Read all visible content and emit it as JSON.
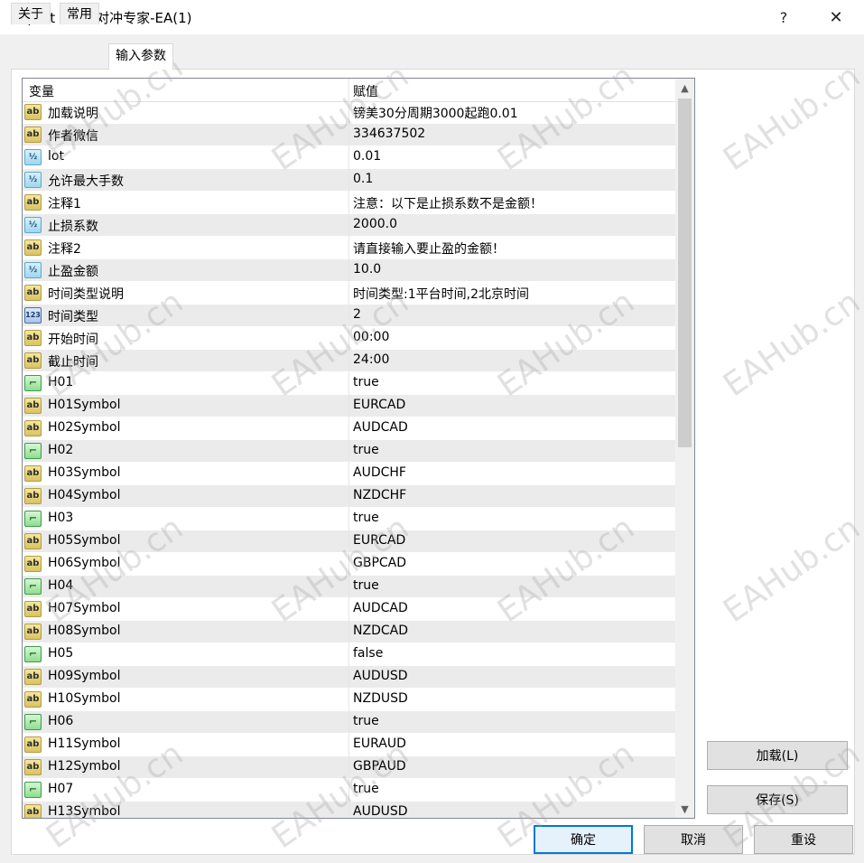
{
  "window": {
    "title": "Expert - 货币对冲专家-EA(1)",
    "help_glyph": "?",
    "close_glyph": "✕"
  },
  "tabs": [
    {
      "label": "关于"
    },
    {
      "label": "常用"
    },
    {
      "label": "输入参数"
    }
  ],
  "grid": {
    "col_variable": "变量",
    "col_value": "赋值",
    "rows": [
      {
        "type": "ab",
        "name": "加载说明",
        "value": "镑美30分周期3000起跑0.01"
      },
      {
        "type": "ab",
        "name": "作者微信",
        "value": "334637502"
      },
      {
        "type": "½",
        "name": "lot",
        "value": "0.01"
      },
      {
        "type": "½",
        "name": "允许最大手数",
        "value": "0.1"
      },
      {
        "type": "ab",
        "name": "注释1",
        "value": "注意：以下是止损系数不是金额！"
      },
      {
        "type": "½",
        "name": "止损系数",
        "value": "2000.0"
      },
      {
        "type": "ab",
        "name": "注释2",
        "value": "请直接输入要止盈的金额！"
      },
      {
        "type": "½",
        "name": "止盈金额",
        "value": "10.0"
      },
      {
        "type": "ab",
        "name": "时间类型说明",
        "value": "时间类型:1平台时间,2北京时间"
      },
      {
        "type": "123",
        "name": "时间类型",
        "value": "2"
      },
      {
        "type": "ab",
        "name": "开始时间",
        "value": "00:00"
      },
      {
        "type": "ab",
        "name": "截止时间",
        "value": "24:00"
      },
      {
        "type": "⌐",
        "name": "H01",
        "value": "true"
      },
      {
        "type": "ab",
        "name": "H01Symbol",
        "value": "EURCAD"
      },
      {
        "type": "ab",
        "name": "H02Symbol",
        "value": "AUDCAD"
      },
      {
        "type": "⌐",
        "name": "H02",
        "value": "true"
      },
      {
        "type": "ab",
        "name": "H03Symbol",
        "value": "AUDCHF"
      },
      {
        "type": "ab",
        "name": "H04Symbol",
        "value": "NZDCHF"
      },
      {
        "type": "⌐",
        "name": "H03",
        "value": "true"
      },
      {
        "type": "ab",
        "name": "H05Symbol",
        "value": "EURCAD"
      },
      {
        "type": "ab",
        "name": "H06Symbol",
        "value": "GBPCAD"
      },
      {
        "type": "⌐",
        "name": "H04",
        "value": "true"
      },
      {
        "type": "ab",
        "name": "H07Symbol",
        "value": "AUDCAD"
      },
      {
        "type": "ab",
        "name": "H08Symbol",
        "value": "NZDCAD"
      },
      {
        "type": "⌐",
        "name": "H05",
        "value": "false"
      },
      {
        "type": "ab",
        "name": "H09Symbol",
        "value": "AUDUSD"
      },
      {
        "type": "ab",
        "name": "H10Symbol",
        "value": "NZDUSD"
      },
      {
        "type": "⌐",
        "name": "H06",
        "value": "true"
      },
      {
        "type": "ab",
        "name": "H11Symbol",
        "value": "EURAUD"
      },
      {
        "type": "ab",
        "name": "H12Symbol",
        "value": "GBPAUD"
      },
      {
        "type": "⌐",
        "name": "H07",
        "value": "true"
      },
      {
        "type": "ab",
        "name": "H13Symbol",
        "value": "AUDUSD"
      }
    ]
  },
  "buttons": {
    "load": "加载(L)",
    "save": "保存(S)",
    "ok": "确定",
    "cancel": "取消",
    "reset": "重设"
  },
  "watermark_text": "EAHub.cn"
}
